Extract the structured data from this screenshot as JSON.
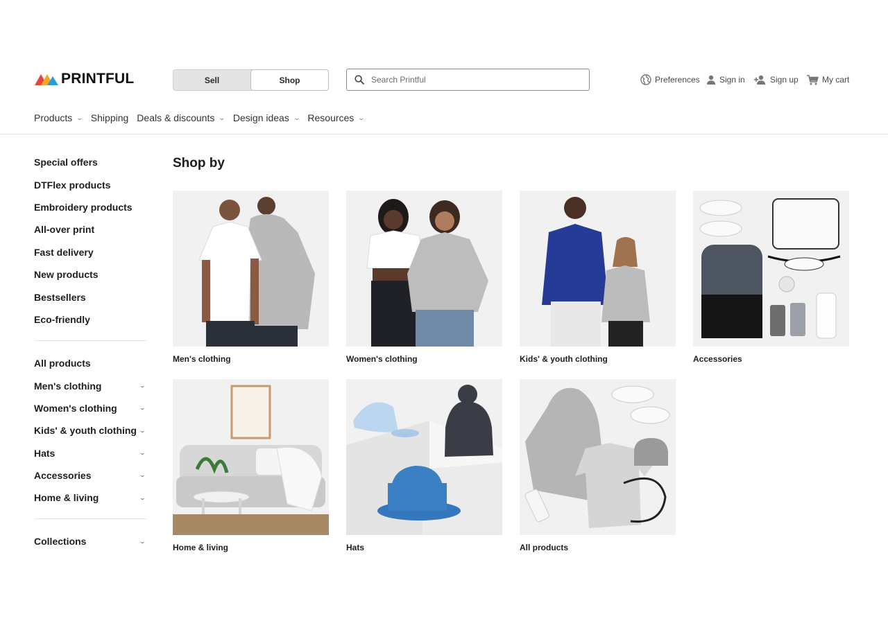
{
  "brand": {
    "name": "PRINTFUL"
  },
  "mode_toggle": {
    "options": [
      "Sell",
      "Shop"
    ],
    "selected": "Shop"
  },
  "search": {
    "placeholder": "Search Printful",
    "value": ""
  },
  "utility_nav": {
    "preferences": "Preferences",
    "sign_in": "Sign in",
    "sign_up": "Sign up",
    "cart": "My cart"
  },
  "main_nav": [
    {
      "label": "Products",
      "has_dropdown": true
    },
    {
      "label": "Shipping",
      "has_dropdown": false
    },
    {
      "label": "Deals & discounts",
      "has_dropdown": true
    },
    {
      "label": "Design ideas",
      "has_dropdown": true
    },
    {
      "label": "Resources",
      "has_dropdown": true
    }
  ],
  "sidebar": {
    "quick_links": [
      "Special offers",
      "DTFlex products",
      "Embroidery products",
      "All-over print",
      "Fast delivery",
      "New products",
      "Bestsellers",
      "Eco-friendly"
    ],
    "all_products": "All products",
    "categories": [
      "Men's clothing",
      "Women's clothing",
      "Kids' & youth clothing",
      "Hats",
      "Accessories",
      "Home & living"
    ],
    "collections": "Collections"
  },
  "main": {
    "title": "Shop by",
    "cards": [
      {
        "label": "Men's clothing",
        "image": "mens-clothing-image"
      },
      {
        "label": "Women's clothing",
        "image": "womens-clothing-image"
      },
      {
        "label": "Kids' & youth clothing",
        "image": "kids-youth-clothing-image"
      },
      {
        "label": "Accessories",
        "image": "accessories-image"
      },
      {
        "label": "Home & living",
        "image": "home-living-image"
      },
      {
        "label": "Hats",
        "image": "hats-image"
      },
      {
        "label": "All products",
        "image": "all-products-image"
      }
    ]
  },
  "colors": {
    "text": "#1e1e1e",
    "card_bg": "#f1f1f1",
    "logo_red": "#e8463c",
    "logo_orange": "#f5a623",
    "logo_blue": "#2e9bd6"
  }
}
